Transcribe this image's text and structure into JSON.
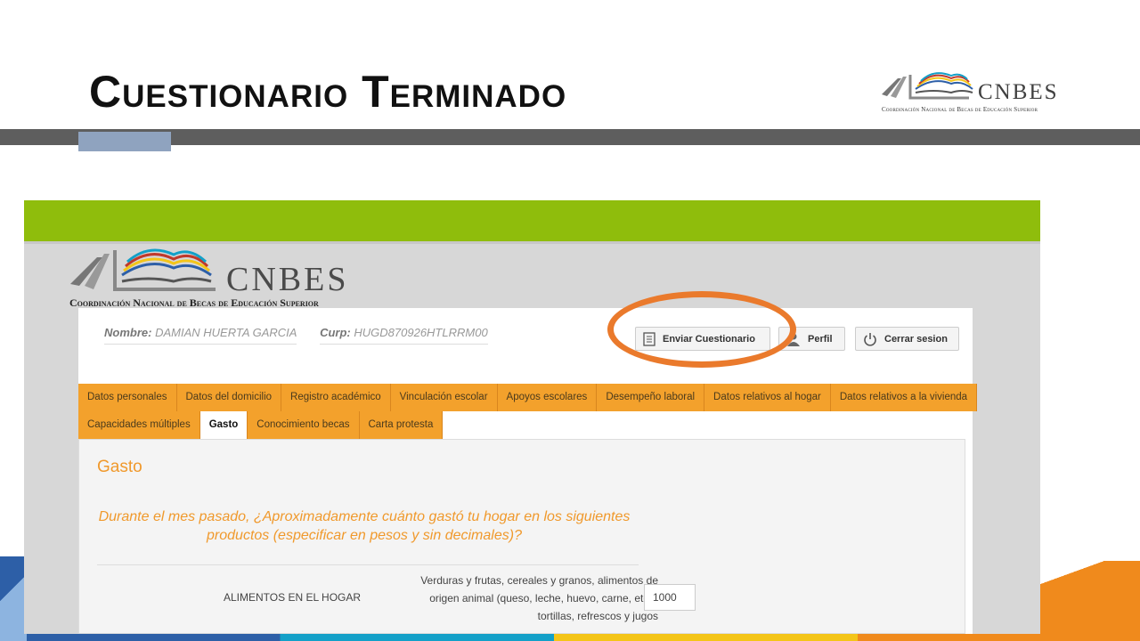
{
  "slide": {
    "title": "Cuestionario Terminado",
    "logo_word": "CNBES",
    "logo_sub": "Coordinación Nacional de Becas de Educación Superior"
  },
  "app": {
    "logo_word": "CNBES",
    "logo_sub": "Coordinación Nacional de Becas de Educación Superior",
    "user": {
      "nombre_label": "Nombre:",
      "nombre_value": "DAMIAN HUERTA GARCIA",
      "curp_label": "Curp:",
      "curp_value": "HUGD870926HTLRRM00"
    },
    "buttons": {
      "enviar": "Enviar Cuestionario",
      "perfil": "Perfil",
      "cerrar": "Cerrar sesion"
    },
    "tabs_row1": [
      "Datos personales",
      "Datos del domicilio",
      "Registro académico",
      "Vinculación escolar",
      "Apoyos escolares",
      "Desempeño laboral",
      "Datos relativos al hogar",
      "Datos relativos a la vivienda"
    ],
    "tabs_row2": [
      "Capacidades múltiples",
      "Gasto",
      "Conocimiento becas",
      "Carta protesta"
    ],
    "active_tab": "Gasto",
    "section": {
      "title": "Gasto",
      "question": "Durante el mes pasado, ¿Aproximadamente cuánto gastó tu hogar en los siguientes productos (especificar en pesos y sin decimales)?",
      "rows": [
        {
          "label": "ALIMENTOS EN EL HOGAR",
          "description_lines": [
            "Verduras y frutas, cereales y granos, alimentos de",
            "origen animal (queso, leche, huevo, carne, etc.),",
            "tortillas, refrescos y jugos"
          ],
          "value": "1000"
        }
      ]
    }
  },
  "colors": {
    "green_bar": "#8fbd0c",
    "tab_orange": "#f3a12c",
    "highlight": "#ea7a2c",
    "section_text": "#f0992c"
  }
}
